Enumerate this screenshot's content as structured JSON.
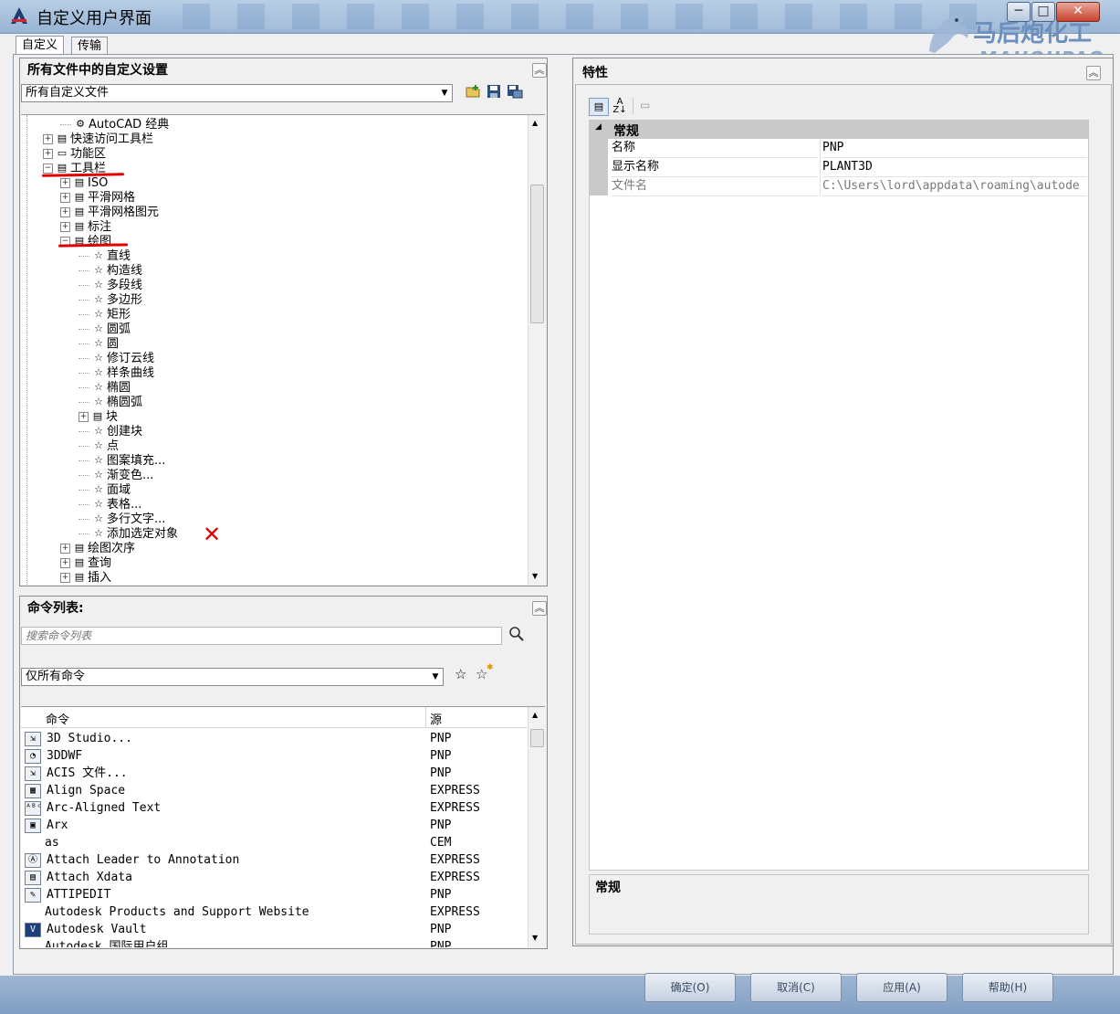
{
  "window": {
    "title": "自定义用户界面",
    "minimize": "─",
    "maximize": "□",
    "close": "✕"
  },
  "watermark": {
    "line1": "马后炮化工",
    "line2": "MAHOUPAO"
  },
  "tabs": [
    {
      "label": "自定义"
    },
    {
      "label": "传输"
    }
  ],
  "customizations": {
    "header": "所有文件中的自定义设置",
    "collapse_glyph": "︽",
    "file_combo": "所有自定义文件",
    "tree": [
      {
        "label": "AutoCAD 经典",
        "level": 2,
        "icon": "gear-icon",
        "glyph": "⚙",
        "expander": ""
      },
      {
        "label": "快速访问工具栏",
        "level": 1,
        "icon": "toolbar-icon",
        "glyph": "▤",
        "expander": "+"
      },
      {
        "label": "功能区",
        "level": 1,
        "icon": "ribbon-icon",
        "glyph": "▭",
        "expander": "+"
      },
      {
        "label": "工具栏",
        "level": 1,
        "icon": "toolbar-icon",
        "glyph": "▤",
        "expander": "−"
      },
      {
        "label": "ISO",
        "level": 2,
        "icon": "toolbar-icon",
        "glyph": "▤",
        "expander": "+"
      },
      {
        "label": "平滑网格",
        "level": 2,
        "icon": "toolbar-icon",
        "glyph": "▤",
        "expander": "+"
      },
      {
        "label": "平滑网格图元",
        "level": 2,
        "icon": "toolbar-icon",
        "glyph": "▤",
        "expander": "+"
      },
      {
        "label": "标注",
        "level": 2,
        "icon": "toolbar-icon",
        "glyph": "▤",
        "expander": "+"
      },
      {
        "label": "绘图",
        "level": 2,
        "icon": "toolbar-icon",
        "glyph": "▤",
        "expander": "−"
      },
      {
        "label": "直线",
        "level": 3,
        "icon": "star-icon",
        "glyph": "☆",
        "expander": ""
      },
      {
        "label": "构造线",
        "level": 3,
        "icon": "star-icon",
        "glyph": "☆",
        "expander": ""
      },
      {
        "label": "多段线",
        "level": 3,
        "icon": "star-icon",
        "glyph": "☆",
        "expander": ""
      },
      {
        "label": "多边形",
        "level": 3,
        "icon": "star-icon",
        "glyph": "☆",
        "expander": ""
      },
      {
        "label": "矩形",
        "level": 3,
        "icon": "star-icon",
        "glyph": "☆",
        "expander": ""
      },
      {
        "label": "圆弧",
        "level": 3,
        "icon": "star-icon",
        "glyph": "☆",
        "expander": ""
      },
      {
        "label": "圆",
        "level": 3,
        "icon": "star-icon",
        "glyph": "☆",
        "expander": ""
      },
      {
        "label": "修订云线",
        "level": 3,
        "icon": "star-icon",
        "glyph": "☆",
        "expander": ""
      },
      {
        "label": "样条曲线",
        "level": 3,
        "icon": "star-icon",
        "glyph": "☆",
        "expander": ""
      },
      {
        "label": "椭圆",
        "level": 3,
        "icon": "star-icon",
        "glyph": "☆",
        "expander": ""
      },
      {
        "label": "椭圆弧",
        "level": 3,
        "icon": "star-icon",
        "glyph": "☆",
        "expander": ""
      },
      {
        "label": "块",
        "level": 3,
        "icon": "toolbar-icon",
        "glyph": "▤",
        "expander": "+"
      },
      {
        "label": "创建块",
        "level": 3,
        "icon": "star-icon",
        "glyph": "☆",
        "expander": ""
      },
      {
        "label": "点",
        "level": 3,
        "icon": "star-icon",
        "glyph": "☆",
        "expander": ""
      },
      {
        "label": "图案填充...",
        "level": 3,
        "icon": "star-icon",
        "glyph": "☆",
        "expander": ""
      },
      {
        "label": "渐变色...",
        "level": 3,
        "icon": "star-icon",
        "glyph": "☆",
        "expander": ""
      },
      {
        "label": "面域",
        "level": 3,
        "icon": "star-icon",
        "glyph": "☆",
        "expander": ""
      },
      {
        "label": "表格...",
        "level": 3,
        "icon": "star-icon",
        "glyph": "☆",
        "expander": ""
      },
      {
        "label": "多行文字...",
        "level": 3,
        "icon": "star-icon",
        "glyph": "☆",
        "expander": ""
      },
      {
        "label": "添加选定对象",
        "level": 3,
        "icon": "star-icon",
        "glyph": "☆",
        "expander": ""
      },
      {
        "label": "绘图次序",
        "level": 2,
        "icon": "toolbar-icon",
        "glyph": "▤",
        "expander": "+"
      },
      {
        "label": "查询",
        "level": 2,
        "icon": "toolbar-icon",
        "glyph": "▤",
        "expander": "+"
      },
      {
        "label": "插入",
        "level": 2,
        "icon": "toolbar-icon",
        "glyph": "▤",
        "expander": "+"
      }
    ],
    "annotation_mark": "✕"
  },
  "command_list": {
    "header": "命令列表:",
    "search_placeholder": "搜索命令列表",
    "filter_combo": "仅所有命令",
    "columns": {
      "command": "命令",
      "source": "源"
    },
    "rows": [
      {
        "name": "3D Studio...",
        "source": "PNP",
        "icon": "import-icon",
        "glyph": "⇲"
      },
      {
        "name": "3DDWF",
        "source": "PNP",
        "icon": "dwf-icon",
        "glyph": "◔"
      },
      {
        "name": "ACIS 文件...",
        "source": "PNP",
        "icon": "import-icon",
        "glyph": "⇲"
      },
      {
        "name": "Align Space",
        "source": "EXPRESS",
        "icon": "align-icon",
        "glyph": "▦"
      },
      {
        "name": "Arc-Aligned Text",
        "source": "EXPRESS",
        "icon": "arc-text-icon",
        "glyph": "ᴬᴮᶜ"
      },
      {
        "name": "Arx",
        "source": "PNP",
        "icon": "arx-icon",
        "glyph": "▣"
      },
      {
        "name": "as",
        "source": "CEM",
        "icon": "",
        "glyph": ""
      },
      {
        "name": "Attach Leader to Annotation",
        "source": "EXPRESS",
        "icon": "leader-icon",
        "glyph": "Ⓐ"
      },
      {
        "name": "Attach Xdata",
        "source": "EXPRESS",
        "icon": "xdata-icon",
        "glyph": "▤"
      },
      {
        "name": "ATTIPEDIT",
        "source": "PNP",
        "icon": "attribute-icon",
        "glyph": "✎"
      },
      {
        "name": "Autodesk Products and Support Website",
        "source": "EXPRESS",
        "icon": "",
        "glyph": ""
      },
      {
        "name": "Autodesk Vault",
        "source": "PNP",
        "icon": "vault-icon",
        "glyph": "V"
      },
      {
        "name": "Autodesk 国际用户组",
        "source": "PNP",
        "icon": "",
        "glyph": ""
      }
    ]
  },
  "properties": {
    "header": "特性",
    "section": "常规",
    "rows": [
      {
        "name": "名称",
        "value": "PNP",
        "readonly": false
      },
      {
        "name": "显示名称",
        "value": "PLANT3D",
        "readonly": false
      },
      {
        "name": "文件名",
        "value": "C:\\Users\\lord\\appdata\\roaming\\autode",
        "readonly": true
      }
    ],
    "description_title": "常规"
  },
  "footer_buttons": [
    {
      "label": "确定(O)"
    },
    {
      "label": "取消(C)"
    },
    {
      "label": "应用(A)"
    },
    {
      "label": "帮助(H)"
    }
  ]
}
